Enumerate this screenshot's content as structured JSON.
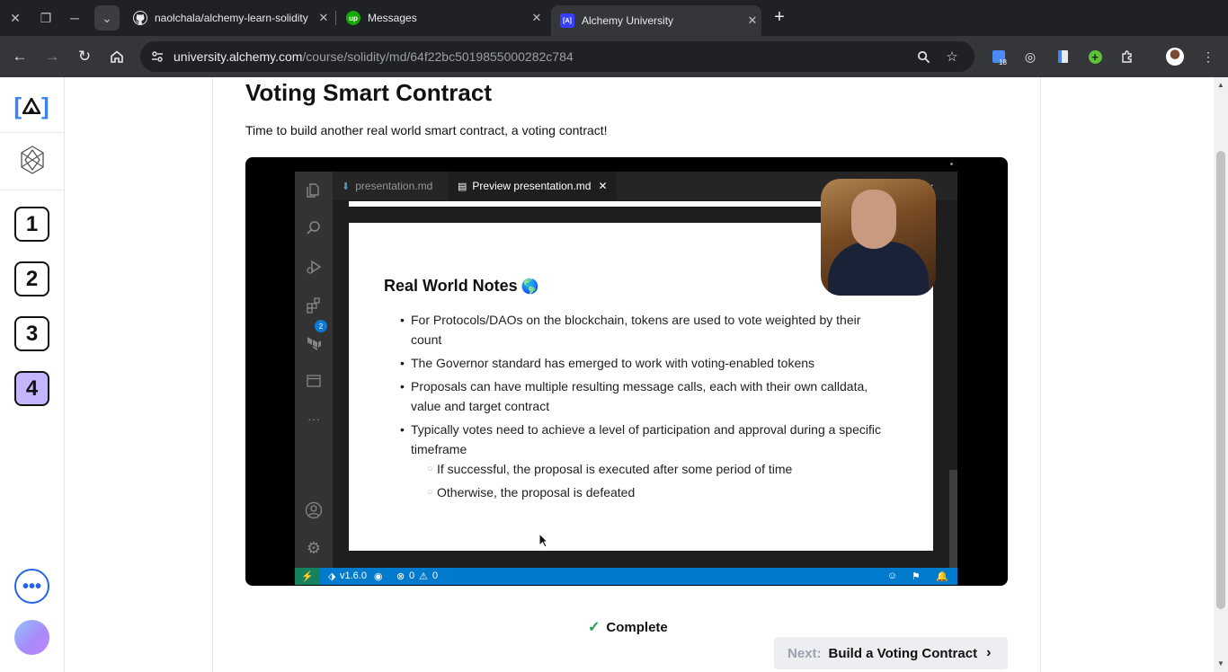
{
  "browser": {
    "tabs": [
      {
        "title": "naolchala/alchemy-learn-solidity",
        "favicon": "github-icon"
      },
      {
        "title": "Messages",
        "favicon": "upwork-icon",
        "favicon_text": "up"
      },
      {
        "title": "Alchemy University",
        "favicon": "alchemy-icon",
        "favicon_text": "[A]"
      }
    ],
    "url_host": "university.alchemy.com",
    "url_path": "/course/solidity/md/64f22bc5019855000282c784",
    "extension_badge": "18",
    "colors": {
      "tabbar": "#202124",
      "toolbar": "#35363a",
      "omnibox": "#202124"
    }
  },
  "sidebar": {
    "logo": "A",
    "sections": [
      "1",
      "2",
      "3",
      "4"
    ],
    "active_section": "4",
    "more": "•••"
  },
  "lesson": {
    "title": "Voting Smart Contract",
    "intro": "Time to build another real world smart contract, a voting contract!",
    "complete_label": "Complete",
    "next_label": "Next:",
    "next_title": "Build a Voting Contract"
  },
  "video": {
    "tabs": [
      "presentation.md",
      "Preview presentation.md"
    ],
    "activity_badge": "2",
    "slide": {
      "title": "Real World Notes",
      "bullets": [
        {
          "line1": "For Protocols/DAOs on the blockchain, tokens are used to vote weighted by their",
          "line2": "count"
        },
        {
          "line1": "The Governor standard has emerged to work with voting-enabled tokens",
          "line2": ""
        },
        {
          "line1": "Proposals can have multiple resulting message calls, each with their own calldata,",
          "line2": "value and target contract"
        },
        {
          "line1": "Typically votes need to achieve a level of participation and approval during a specific",
          "line2": "timeframe"
        }
      ],
      "sub_bullets": [
        "If successful, the proposal is executed after some period of time",
        "Otherwise, the proposal is defeated"
      ]
    },
    "status": {
      "version": "v1.6.0",
      "errors": "0",
      "warnings": "0"
    }
  }
}
